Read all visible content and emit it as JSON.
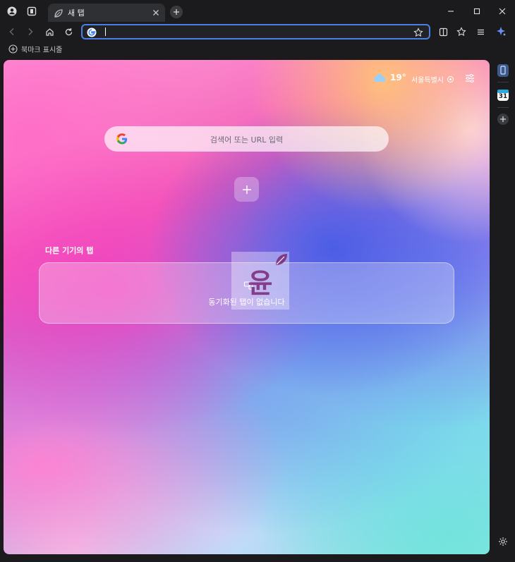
{
  "tabs": [
    {
      "title": "새 탭",
      "active": true
    }
  ],
  "omnibox": {
    "value": "",
    "placeholder": ""
  },
  "bookmarks_bar": {
    "add_label": "북마크 표시줄"
  },
  "weather": {
    "temperature": "19°",
    "location": "서울특별시"
  },
  "search": {
    "placeholder": "검색어 또는 URL 입력"
  },
  "synced_tabs": {
    "title": "다른 기기의 탭",
    "empty_message": "동기화된 탭이 없습니다"
  },
  "watermark": {
    "text": "윤"
  },
  "sidepanel": {
    "calendar_day": "31"
  },
  "colors": {
    "accent": "#4c7fe6",
    "frame": "#1b1b1d",
    "tab_active": "#2f3033"
  }
}
